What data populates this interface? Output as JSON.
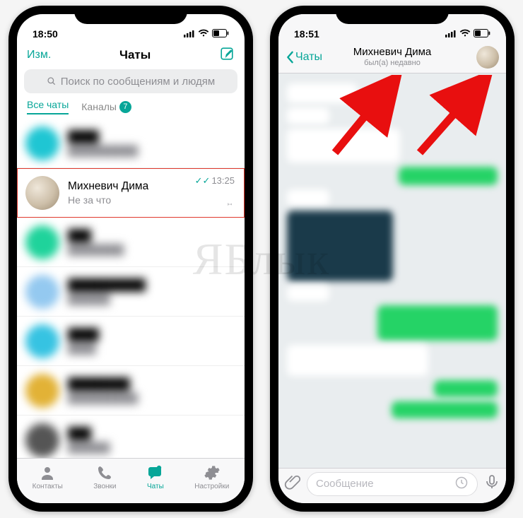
{
  "colors": {
    "accent": "#07a698",
    "danger": "#e0392d",
    "whatsapp_green": "#25d366"
  },
  "left": {
    "status": {
      "time": "18:50"
    },
    "nav": {
      "edit": "Изм.",
      "title": "Чаты"
    },
    "search": {
      "placeholder": "Поиск по сообщениям и людям"
    },
    "tabs": {
      "all": "Все чаты",
      "channels": "Каналы",
      "channel_badge": "7"
    },
    "highlighted_chat": {
      "name": "Михневич Дима",
      "preview": "Не за что",
      "time": "13:25",
      "read": true,
      "pinned": true
    },
    "tabbar": {
      "contacts": "Контакты",
      "calls": "Звонки",
      "chats": "Чаты",
      "settings": "Настройки"
    }
  },
  "right": {
    "status": {
      "time": "18:51"
    },
    "nav": {
      "back": "Чаты",
      "contact": "Михневич Дима",
      "presence": "был(а) недавно"
    },
    "input": {
      "placeholder": "Сообщение"
    }
  },
  "watermark": "ЯБлык"
}
